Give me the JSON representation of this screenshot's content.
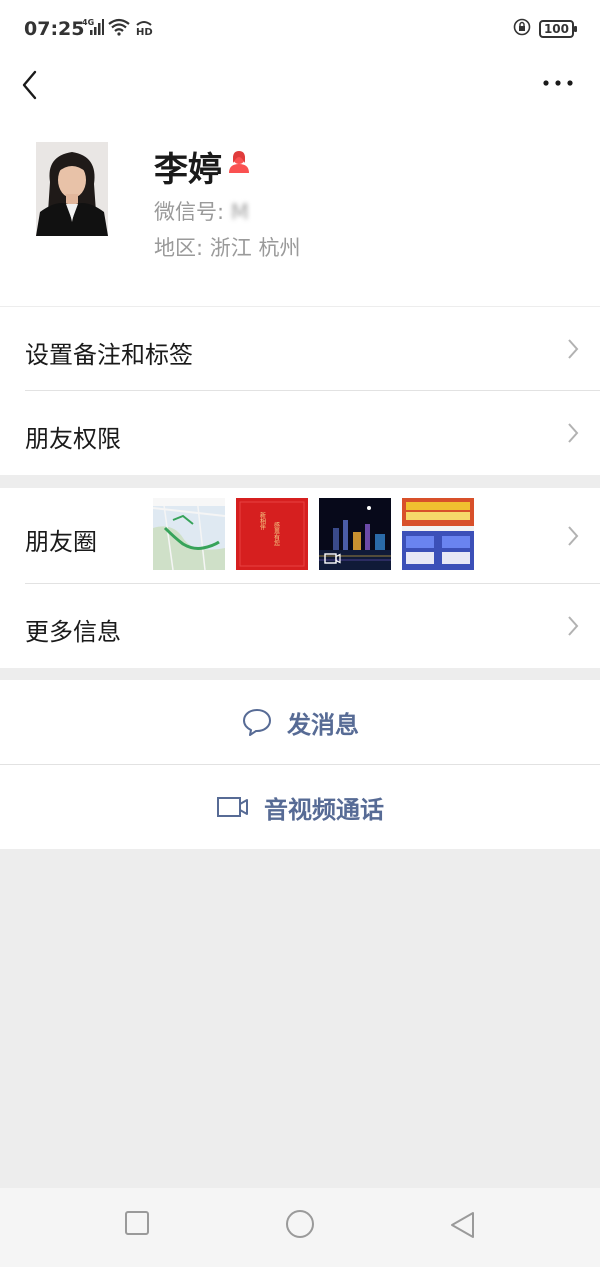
{
  "status_bar": {
    "time": "07:25",
    "network": "4G",
    "hd": "HD",
    "battery": "100"
  },
  "profile": {
    "name": "李婷",
    "wechat_id_label": "微信号: ",
    "wechat_id_value": "M",
    "region_label": "地区: ",
    "region_value": "浙江  杭州"
  },
  "menu": {
    "remarks_tags": "设置备注和标签",
    "friend_permissions": "朋友权限",
    "moments": "朋友圈",
    "more_info": "更多信息"
  },
  "moments_thumbs": [
    {
      "name": "map-thumbnail"
    },
    {
      "name": "red-card-thumbnail",
      "text_a": "感恩有您",
      "text_b": "新相伴"
    },
    {
      "name": "night-city-video-thumbnail"
    },
    {
      "name": "colorful-poster-thumbnail"
    }
  ],
  "actions": {
    "send_message": "发消息",
    "video_call": "音视频通话"
  },
  "colors": {
    "link_blue": "#576b95",
    "background": "#ededed",
    "gender_female": "#fa5151"
  }
}
